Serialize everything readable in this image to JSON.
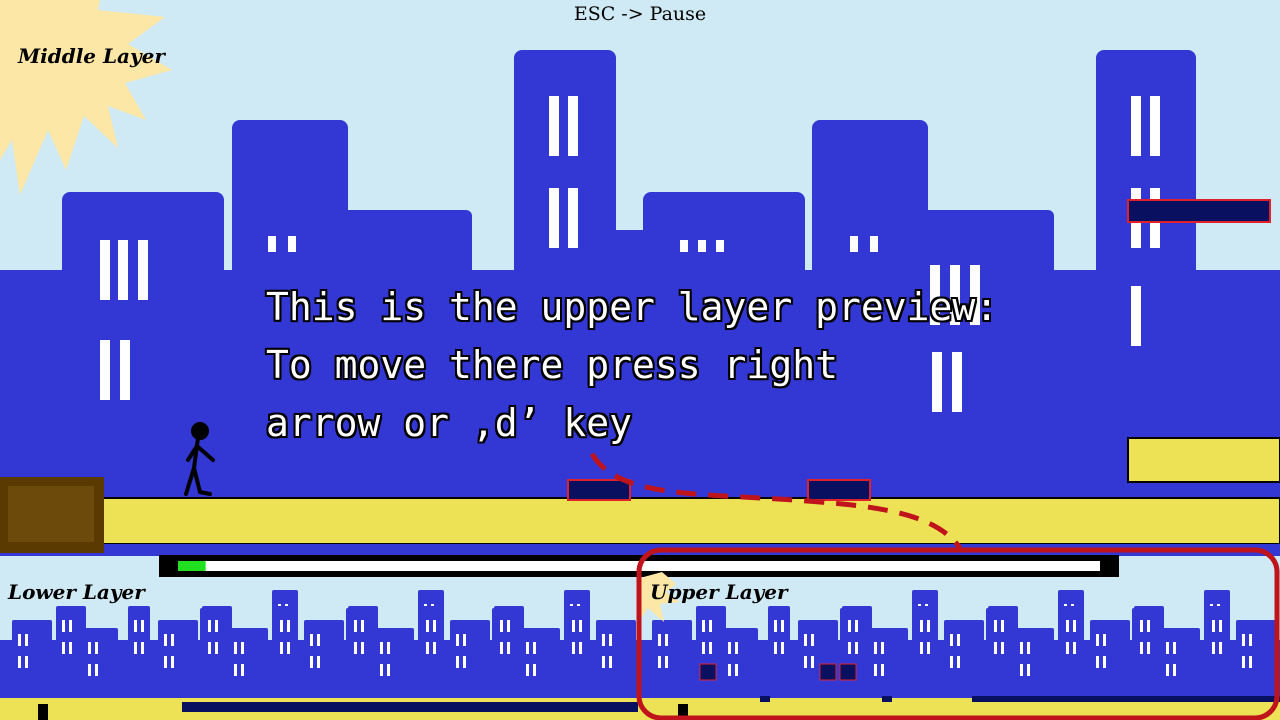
{
  "hud": {
    "pause_hint": "ESC -> Pause",
    "middle_layer_label": "Middle Layer",
    "lower_layer_label": "Lower Layer",
    "upper_layer_label": "Upper Layer",
    "progress": 0.03
  },
  "tutorial": {
    "line1": "This is the upper layer preview:",
    "line2": "To move there press right",
    "line3": "arrow or ‚d’ key"
  },
  "colors": {
    "sky": "#cfeaf4",
    "buildings": "#3338d4",
    "windows": "#ffffff",
    "ground": "#ede155",
    "platform": "#0a1060",
    "platform_border": "#e0202a",
    "crate": "#6b4a0b",
    "highlight": "#c0141c",
    "progress_fill": "#20e020",
    "sun": "#fde7a6"
  }
}
